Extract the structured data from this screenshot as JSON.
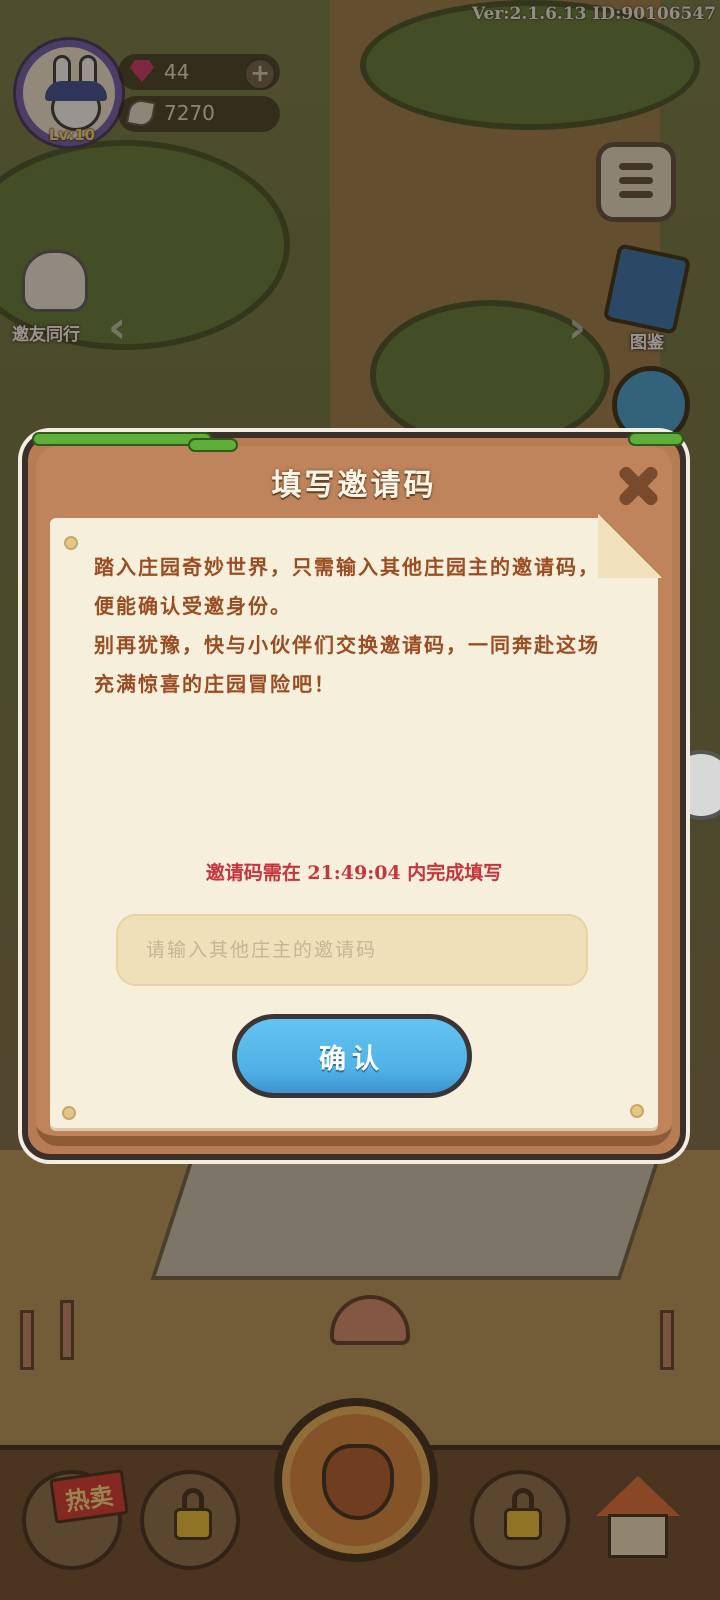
{
  "hud": {
    "version": "Ver:2.1.6.13 ID:90106547",
    "level": "Lv:10",
    "gems": "44",
    "leaves": "7270"
  },
  "side": {
    "invite_friends": "邀友同行",
    "album": "图鉴"
  },
  "dialog": {
    "title": "填写邀请码",
    "intro": "踏入庄园奇妙世界，只需输入其他庄园主的邀请码，便能确认受邀身份。\n别再犹豫，快与小伙伴们交换邀请码，一同奔赴这场充满惊喜的庄园冒险吧！",
    "countdown": "邀请码需在 21:49:04 内完成填写",
    "input_placeholder": "请输入其他庄主的邀请码",
    "input_value": "",
    "confirm_label": "确认"
  },
  "bottom": {
    "hot_tag": "热卖"
  },
  "colors": {
    "title_text": "#fff8ea",
    "intro_text": "#9a4d22",
    "countdown_text": "#c7343c",
    "confirm_button": "#4fb1e6",
    "dialog_frame": "#b87c54"
  },
  "icons": [
    "avatar-bunny",
    "gem-icon",
    "leaf-icon",
    "plus-icon",
    "menu-icon",
    "book-icon",
    "share-icon",
    "hand-icon",
    "close-icon",
    "lock-icon",
    "acorn-icon",
    "shop-icon",
    "house-icon"
  ]
}
